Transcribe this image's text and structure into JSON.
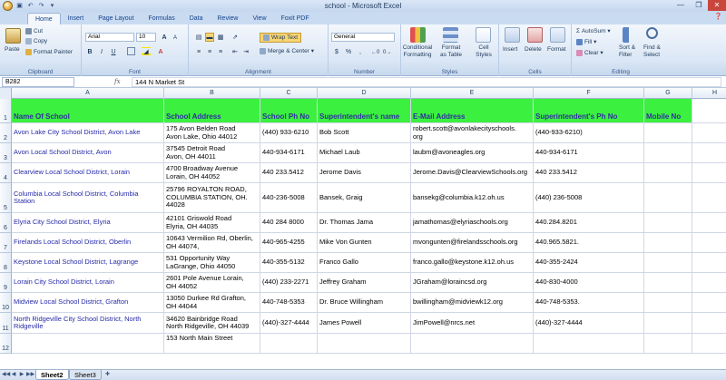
{
  "window": {
    "title": "school - Microsoft Excel"
  },
  "ribbon_tabs": [
    "Home",
    "Insert",
    "Page Layout",
    "Formulas",
    "Data",
    "Review",
    "View",
    "Foxit PDF"
  ],
  "ribbon": {
    "clipboard": {
      "label": "Clipboard",
      "paste": "Paste",
      "cut": "Cut",
      "copy": "Copy",
      "format_painter": "Format Painter"
    },
    "font": {
      "label": "Font",
      "name": "Arial",
      "size": "10",
      "bold": "B",
      "italic": "I",
      "underline": "U",
      "grow": "A",
      "shrink": "A"
    },
    "alignment": {
      "label": "Alignment",
      "wrap": "Wrap Text",
      "merge": "Merge & Center"
    },
    "number": {
      "label": "Number",
      "format": "General",
      "currency": "$",
      "percent": "%",
      "comma": ","
    },
    "styles": {
      "label": "Styles",
      "conditional": "Conditional\nFormatting",
      "as_table": "Format\nas Table",
      "cell_styles": "Cell\nStyles"
    },
    "cells": {
      "label": "Cells",
      "insert": "Insert",
      "delete": "Delete",
      "format": "Format"
    },
    "editing": {
      "label": "Editing",
      "autosum": "AutoSum",
      "fill": "Fill",
      "clear": "Clear",
      "sort": "Sort &\nFilter",
      "find": "Find &\nSelect"
    }
  },
  "formula_bar": {
    "cell_ref": "B282",
    "fx": "fx",
    "value": "144 N Market St"
  },
  "columns": [
    "A",
    "B",
    "C",
    "D",
    "E",
    "F",
    "G",
    "H"
  ],
  "header_row": {
    "row_num": "1",
    "cells": [
      "Name Of School",
      "School Address",
      "School Ph No",
      "Superintendent's name",
      "E-Mail Address",
      "Superintendent's Ph No",
      "Mobile No",
      ""
    ]
  },
  "rows": [
    {
      "num": "2",
      "cells": [
        "Avon Lake City School District, Avon Lake",
        "175 Avon Belden Road\nAvon Lake, Ohio 44012",
        "(440) 933-6210",
        "Bob Scott",
        "robert.scott@avonlakecityschools.\norg",
        "(440-933-6210)",
        "",
        ""
      ]
    },
    {
      "num": "3",
      "cells": [
        "Avon Local School District, Avon",
        "37545 Detroit Road\nAvon, OH 44011",
        "440-934-6171",
        "Michael Laub",
        "laubm@avoneagles.org",
        "440-934-6171",
        "",
        ""
      ]
    },
    {
      "num": "4",
      "cells": [
        "Clearview Local School District, Lorain",
        "4700 Broadway Avenue\nLorain, OH 44052",
        "440 233.5412",
        "Jerome Davis",
        "Jerome.Davis@ClearviewSchools.org",
        "440 233.5412",
        "",
        ""
      ]
    },
    {
      "num": "5",
      "cells": [
        "Columbia Local School District, Columbia\nStation",
        "25796 ROYALTON ROAD,\nCOLUMBIA STATION, OH.\n44028",
        "440-236-5008",
        "Bansek, Graig",
        "bansekg@columbia.k12.oh.us",
        "(440) 236-5008",
        "",
        ""
      ]
    },
    {
      "num": "6",
      "cells": [
        "Elyria City School District, Elyria",
        "42101 Griswold Road\nElyria, OH 44035",
        "440 284 8000",
        "Dr. Thomas Jama",
        "jamathomas@elyriaschools.org",
        "440.284.8201",
        "",
        ""
      ]
    },
    {
      "num": "7",
      "cells": [
        "Firelands Local School District, Oberlin",
        "10643 Vermilion Rd, Oberlin,\nOH 44074,",
        "440-965-4255",
        "Mike Von Gunten",
        "mvongunten@firelandsschools.org",
        "440.965.5821.",
        "",
        ""
      ]
    },
    {
      "num": "8",
      "cells": [
        "Keystone Local School District, Lagrange",
        "531 Opportunity Way\nLaGrange, Ohio 44050",
        "440-355-5132",
        "Franco Gallo",
        "franco.gallo@keystone.k12.oh.us",
        "440-355-2424",
        "",
        ""
      ]
    },
    {
      "num": "9",
      "cells": [
        "Lorain City School District, Lorain",
        "2601 Pole Avenue Lorain,\nOH 44052",
        "(440) 233-2271",
        "Jeffrey Graham",
        "JGraham@loraincsd.org",
        "440-830-4000",
        "",
        ""
      ]
    },
    {
      "num": "10",
      "cells": [
        "Midview Local School District, Grafton",
        "13050 Durkee Rd Grafton,\nOH 44044",
        "440-748-5353",
        "Dr. Bruce Willingham",
        "bwillingham@midviewk12.org",
        "440-748-5353.",
        "",
        ""
      ]
    },
    {
      "num": "11",
      "cells": [
        "North Ridgeville City School District, North\nRidgeville",
        "34620 Bainbridge Road\nNorth Ridgeville, OH 44039",
        "(440)-327-4444",
        "James Powell",
        "JimPowell@nrcs.net",
        "(440)-327-4444",
        "",
        ""
      ]
    },
    {
      "num": "12",
      "cells": [
        "",
        "153 North Main Street",
        "",
        "",
        "",
        "",
        "",
        ""
      ]
    }
  ],
  "sheet_tabs": [
    "Sheet2",
    "Sheet3"
  ],
  "colors": {
    "header_fill": "#3cf040",
    "header_text": "#2f2fa0",
    "name_text": "#262aa8"
  }
}
